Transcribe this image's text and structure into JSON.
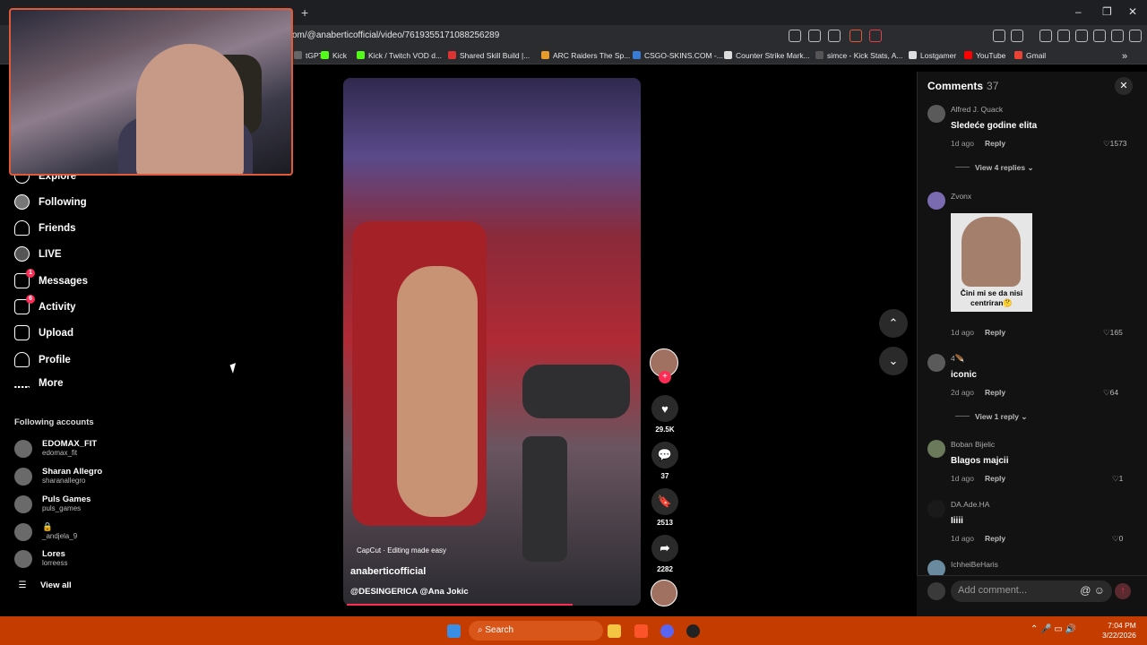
{
  "browser": {
    "url": "om/@anaberticofficial/video/7619355171088256289",
    "new_tab": "+",
    "window_controls": [
      "–",
      "❐",
      "✕"
    ],
    "bookmarks": [
      {
        "label": "tGPT",
        "color": "#666"
      },
      {
        "label": "Kick",
        "color": "#53fc18"
      },
      {
        "label": "Kick / Twitch VOD d...",
        "color": "#53fc18"
      },
      {
        "label": "Shared Skill Build |...",
        "color": "#d33"
      },
      {
        "label": "ARC Raiders The Sp...",
        "color": "#e89a2a"
      },
      {
        "label": "CSGO-SKINS.COM -...",
        "color": "#3a7bd5"
      },
      {
        "label": "Counter Strike Mark...",
        "color": "#ddd"
      },
      {
        "label": "simce - Kick Stats, A...",
        "color": "#555"
      },
      {
        "label": "Lostgamer",
        "color": "#ddd"
      },
      {
        "label": "YouTube",
        "color": "#f00"
      },
      {
        "label": "Gmail",
        "color": "#ea4335"
      }
    ]
  },
  "sidebar": {
    "items": [
      {
        "label": "Explore",
        "icon": "compass-icon"
      },
      {
        "label": "Following",
        "icon": "following-avatar-icon"
      },
      {
        "label": "Friends",
        "icon": "friends-icon"
      },
      {
        "label": "LIVE",
        "icon": "live-icon"
      },
      {
        "label": "Messages",
        "icon": "send-icon",
        "badge": "1"
      },
      {
        "label": "Activity",
        "icon": "activity-icon",
        "badge": "6"
      },
      {
        "label": "Upload",
        "icon": "upload-icon"
      },
      {
        "label": "Profile",
        "icon": "profile-icon"
      },
      {
        "label": "More",
        "icon": "more-icon"
      }
    ],
    "following_title": "Following accounts",
    "accounts": [
      {
        "name": "EDOMAX_FIT",
        "handle": "edomax_fit"
      },
      {
        "name": "Sharan Allegro",
        "handle": "sharanallegro"
      },
      {
        "name": "Puls Games",
        "handle": "puls_games"
      },
      {
        "name": "🔒",
        "handle": "_andjela_9"
      },
      {
        "name": "Lores",
        "handle": "lorreess"
      }
    ],
    "view_all": "View all"
  },
  "video": {
    "capcut": "CapCut · Editing made easy",
    "author": "anaberticofficial",
    "description": "@DESINGERICA @Ana Jokic",
    "progress": 0.76
  },
  "actions": {
    "likes": "29.5K",
    "comments": "37",
    "saves": "2513",
    "shares": "2282"
  },
  "comments_panel": {
    "title": "Comments",
    "count": "37",
    "reply_label": "Reply",
    "add_placeholder": "Add comment...",
    "comments": [
      {
        "user": "Alfred J. Quack",
        "text": "Sledeće godine elita",
        "time": "1d ago",
        "likes": "1573",
        "views": "View 4 replies"
      },
      {
        "user": "Zvonx",
        "text": "",
        "time": "1d ago",
        "likes": "165",
        "meme_caption": "Čini mi se da nisi centriran🤔"
      },
      {
        "user": "4🪶",
        "text": "iconic",
        "time": "2d ago",
        "likes": "64",
        "views": "View 1 reply"
      },
      {
        "user": "Boban Bijelic",
        "text": "Blagos majcii",
        "time": "1d ago",
        "likes": "1"
      },
      {
        "user": "DA.Ade.HA",
        "text": "Iiiii",
        "time": "1d ago",
        "likes": "0"
      },
      {
        "user": "IchheiBeHaris",
        "text": "",
        "time": "",
        "likes": ""
      }
    ]
  },
  "taskbar": {
    "search": "Search",
    "time": "7:04 PM",
    "date": "3/22/2026"
  }
}
